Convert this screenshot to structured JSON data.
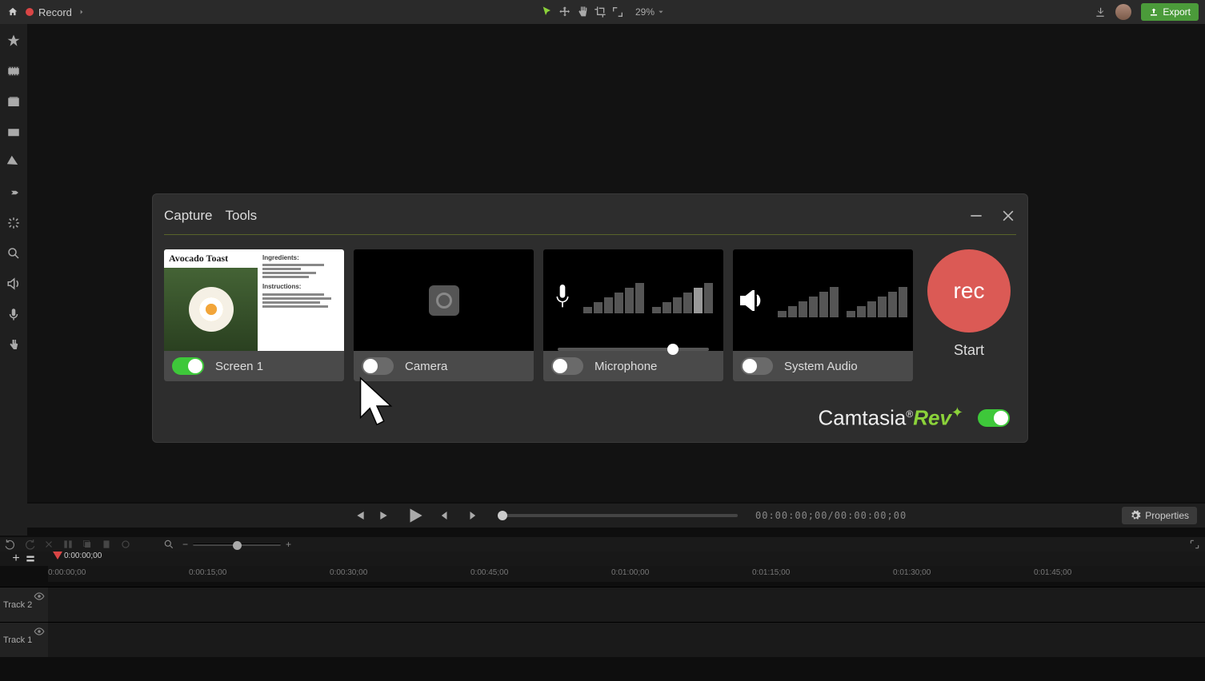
{
  "topbar": {
    "record_label": "Record",
    "zoom_value": "29%",
    "export_label": "Export"
  },
  "dialog": {
    "tab_capture": "Capture",
    "tab_tools": "Tools",
    "cards": {
      "screen": {
        "label": "Screen 1",
        "preview_title": "Avocado Toast",
        "preview_h1": "Ingredients:",
        "preview_h2": "Instructions:"
      },
      "camera": {
        "label": "Camera"
      },
      "microphone": {
        "label": "Microphone"
      },
      "system_audio": {
        "label": "System Audio"
      }
    },
    "rec_button_text": "rec",
    "rec_label": "Start",
    "brand_prefix": "Camtasia",
    "brand_suffix": "Rev"
  },
  "playback": {
    "timecode": "00:00:00;00/00:00:00;00",
    "properties_label": "Properties"
  },
  "timeline": {
    "playhead_time": "0:00:00;00",
    "marks": [
      "0:00:00;00",
      "0:00:15;00",
      "0:00:30;00",
      "0:00:45;00",
      "0:01:00;00",
      "0:01:15;00",
      "0:01:30;00",
      "0:01:45;00"
    ],
    "track2_label": "Track 2",
    "track1_label": "Track 1"
  }
}
